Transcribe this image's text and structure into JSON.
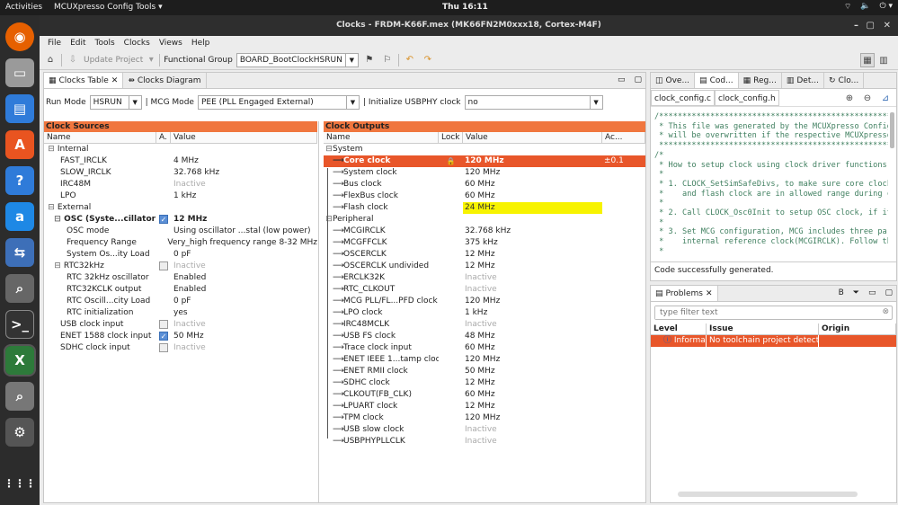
{
  "topbar": {
    "activities": "Activities",
    "app": "MCUXpresso Config Tools ▾",
    "time": "Thu 16:11",
    "tray": [
      "⌔",
      "🔈",
      "⏻ ▾"
    ]
  },
  "window": {
    "title": "Clocks - FRDM-K66F.mex (MK66FN2M0xxx18, Cortex-M4F)"
  },
  "menu": [
    "File",
    "Edit",
    "Tools",
    "Clocks",
    "Views",
    "Help"
  ],
  "toolbar": {
    "update_project": "Update Project",
    "functional_group_label": "Functional Group",
    "functional_group": "BOARD_BootClockHSRUN"
  },
  "left_tabs": [
    "Clocks Table",
    "Clocks Diagram"
  ],
  "settings": {
    "run_mode_label": "Run Mode",
    "run_mode": "HSRUN",
    "mcg_mode_label": "| MCG Mode",
    "mcg_mode": "PEE (PLL Engaged External)",
    "usbphy_label": "| Initialize USBPHY clock",
    "usbphy": "no"
  },
  "sources": {
    "title": "Clock Sources",
    "cols": [
      "Name",
      "A.",
      "Value"
    ],
    "rows": [
      {
        "name": "Internal",
        "value": "",
        "indent": 0,
        "exp": "⊟",
        "inactive": false,
        "check": null,
        "bold": false
      },
      {
        "name": "FAST_IRCLK",
        "value": "4 MHz",
        "indent": 2,
        "exp": "",
        "inactive": false,
        "check": null,
        "bold": false
      },
      {
        "name": "SLOW_IRCLK",
        "value": "32.768 kHz",
        "indent": 2,
        "exp": "",
        "inactive": false,
        "check": null,
        "bold": false
      },
      {
        "name": "IRC48M",
        "value": "Inactive",
        "indent": 2,
        "exp": "",
        "inactive": true,
        "check": null,
        "bold": false
      },
      {
        "name": "LPO",
        "value": "1 kHz",
        "indent": 2,
        "exp": "",
        "inactive": false,
        "check": null,
        "bold": false
      },
      {
        "name": "External",
        "value": "",
        "indent": 0,
        "exp": "⊟",
        "inactive": false,
        "check": null,
        "bold": false
      },
      {
        "name": "OSC (Syste...cillator)",
        "value": "12 MHz",
        "indent": 1,
        "exp": "⊟",
        "inactive": false,
        "check": "on",
        "bold": true
      },
      {
        "name": "OSC mode",
        "value": "Using oscillator ...stal (low power)",
        "indent": 3,
        "exp": "",
        "inactive": false,
        "check": null,
        "bold": false
      },
      {
        "name": "Frequency Range",
        "value": "Very_high frequency range 8-32 MHz",
        "indent": 3,
        "exp": "",
        "inactive": false,
        "check": null,
        "bold": false
      },
      {
        "name": "System Os...ity Load",
        "value": "0 pF",
        "indent": 3,
        "exp": "",
        "inactive": false,
        "check": null,
        "bold": false
      },
      {
        "name": "RTC32kHz",
        "value": "Inactive",
        "indent": 1,
        "exp": "⊟",
        "inactive": true,
        "check": "off",
        "bold": false
      },
      {
        "name": "RTC 32kHz oscillator",
        "value": "Enabled",
        "indent": 3,
        "exp": "",
        "inactive": false,
        "check": null,
        "bold": false
      },
      {
        "name": "RTC32KCLK output",
        "value": "Enabled",
        "indent": 3,
        "exp": "",
        "inactive": false,
        "check": null,
        "bold": false
      },
      {
        "name": "RTC Oscill...city Load",
        "value": "0 pF",
        "indent": 3,
        "exp": "",
        "inactive": false,
        "check": null,
        "bold": false
      },
      {
        "name": "RTC initialization",
        "value": "yes",
        "indent": 3,
        "exp": "",
        "inactive": false,
        "check": null,
        "bold": false
      },
      {
        "name": "USB clock input",
        "value": "Inactive",
        "indent": 2,
        "exp": "",
        "inactive": true,
        "check": "off",
        "bold": false
      },
      {
        "name": "ENET 1588 clock input",
        "value": "50 MHz",
        "indent": 2,
        "exp": "",
        "inactive": false,
        "check": "on",
        "bold": false
      },
      {
        "name": "SDHC clock input",
        "value": "Inactive",
        "indent": 2,
        "exp": "",
        "inactive": true,
        "check": "off",
        "bold": false
      }
    ]
  },
  "outputs": {
    "title": "Clock Outputs",
    "cols": [
      "Name",
      "Lock",
      "Value",
      "Ac..."
    ],
    "rows": [
      {
        "name": "System",
        "value": "",
        "group": true,
        "inactive": false,
        "state": ""
      },
      {
        "name": "Core clock",
        "value": "120 MHz",
        "group": false,
        "inactive": false,
        "state": "selected",
        "lock": "🔒",
        "acc": "±0.1"
      },
      {
        "name": "System clock",
        "value": "120 MHz",
        "group": false,
        "inactive": false,
        "state": ""
      },
      {
        "name": "Bus clock",
        "value": "60 MHz",
        "group": false,
        "inactive": false,
        "state": ""
      },
      {
        "name": "FlexBus clock",
        "value": "60 MHz",
        "group": false,
        "inactive": false,
        "state": ""
      },
      {
        "name": "Flash clock",
        "value": "24 MHz",
        "group": false,
        "inactive": false,
        "state": "warn"
      },
      {
        "name": "Peripheral",
        "value": "",
        "group": true,
        "inactive": false,
        "state": ""
      },
      {
        "name": "MCGIRCLK",
        "value": "32.768 kHz",
        "group": false,
        "inactive": false,
        "state": ""
      },
      {
        "name": "MCGFFCLK",
        "value": "375 kHz",
        "group": false,
        "inactive": false,
        "state": ""
      },
      {
        "name": "OSCERCLK",
        "value": "12 MHz",
        "group": false,
        "inactive": false,
        "state": ""
      },
      {
        "name": "OSCERCLK undivided",
        "value": "12 MHz",
        "group": false,
        "inactive": false,
        "state": ""
      },
      {
        "name": "ERCLK32K",
        "value": "Inactive",
        "group": false,
        "inactive": true,
        "state": ""
      },
      {
        "name": "RTC_CLKOUT",
        "value": "Inactive",
        "group": false,
        "inactive": true,
        "state": ""
      },
      {
        "name": "MCG PLL/FL...PFD clock",
        "value": "120 MHz",
        "group": false,
        "inactive": false,
        "state": ""
      },
      {
        "name": "LPO clock",
        "value": "1 kHz",
        "group": false,
        "inactive": false,
        "state": ""
      },
      {
        "name": "IRC48MCLK",
        "value": "Inactive",
        "group": false,
        "inactive": true,
        "state": ""
      },
      {
        "name": "USB FS clock",
        "value": "48 MHz",
        "group": false,
        "inactive": false,
        "state": ""
      },
      {
        "name": "Trace clock input",
        "value": "60 MHz",
        "group": false,
        "inactive": false,
        "state": ""
      },
      {
        "name": "ENET IEEE 1...tamp clock",
        "value": "120 MHz",
        "group": false,
        "inactive": false,
        "state": ""
      },
      {
        "name": "ENET RMII clock",
        "value": "50 MHz",
        "group": false,
        "inactive": false,
        "state": ""
      },
      {
        "name": "SDHC clock",
        "value": "12 MHz",
        "group": false,
        "inactive": false,
        "state": ""
      },
      {
        "name": "CLKOUT(FB_CLK)",
        "value": "60 MHz",
        "group": false,
        "inactive": false,
        "state": ""
      },
      {
        "name": "LPUART clock",
        "value": "12 MHz",
        "group": false,
        "inactive": false,
        "state": ""
      },
      {
        "name": "TPM clock",
        "value": "120 MHz",
        "group": false,
        "inactive": false,
        "state": ""
      },
      {
        "name": "USB slow clock",
        "value": "Inactive",
        "group": false,
        "inactive": true,
        "state": ""
      },
      {
        "name": "USBPHYPLLCLK",
        "value": "Inactive",
        "group": false,
        "inactive": true,
        "state": ""
      }
    ]
  },
  "right_tabs": [
    "Ove...",
    "Cod...",
    "Reg...",
    "Det...",
    "Clo..."
  ],
  "code": {
    "file_tabs": [
      "clock_config.c",
      "clock_config.h"
    ],
    "lines": [
      "/*******************************************************",
      " * This file was generated by the MCUXpresso Config",
      " * will be overwritten if the respective MCUXpresso",
      " *******************************************************",
      "/*",
      " * How to setup clock using clock driver functions:",
      " *",
      " * 1. CLOCK_SetSimSafeDivs, to make sure core clock,",
      " *    and flash clock are in allowed range during cl",
      " *",
      " * 2. Call CLOCK_Osc0Init to setup OSC clock, if it",
      " *",
      " * 3. Set MCG configuration, MCG includes three part",
      " *    internal reference clock(MCGIRCLK). Follow the",
      " *"
    ],
    "status": "Code successfully generated."
  },
  "problems": {
    "tab": "Problems",
    "filter_placeholder": "type filter text",
    "cols": [
      "Level",
      "Issue",
      "Origin"
    ],
    "rows": [
      {
        "level": "Informa",
        "issue": "No toolchain project detecte",
        "origin": ""
      }
    ]
  }
}
